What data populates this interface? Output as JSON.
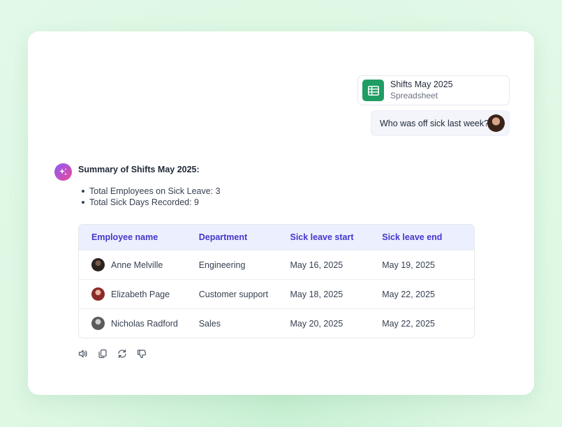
{
  "attachment": {
    "title": "Shifts May 2025",
    "subtitle": "Spreadsheet",
    "icon": "spreadsheet-icon",
    "color": "#1f9d63"
  },
  "user_message": {
    "text": "Who was off sick last week?",
    "avatar": "user-avatar"
  },
  "assistant": {
    "icon": "sparkle-icon",
    "heading": "Summary of Shifts May 2025:",
    "bullets": [
      "Total Employees on Sick Leave: 3",
      "Total Sick Days Recorded: 9"
    ]
  },
  "table": {
    "headers": [
      "Employee name",
      "Department",
      "Sick leave start",
      "Sick leave end"
    ],
    "rows": [
      {
        "name": "Anne Melville",
        "department": "Engineering",
        "start": "May 16, 2025",
        "end": "May 19, 2025",
        "avatar_color": "#2b2320"
      },
      {
        "name": "Elizabeth Page",
        "department": "Customer support",
        "start": "May 18, 2025",
        "end": "May 22, 2025",
        "avatar_color": "#8a2a2a"
      },
      {
        "name": "Nicholas Radford",
        "department": "Sales",
        "start": "May 20, 2025",
        "end": "May 22, 2025",
        "avatar_color": "#5b5b5b"
      }
    ]
  },
  "actions": [
    "speaker-icon",
    "copy-icon",
    "regenerate-icon",
    "thumbs-down-icon"
  ],
  "colors": {
    "background": "#dcf7e3",
    "accent": "#4338ca",
    "header_bg": "#eceffd"
  }
}
